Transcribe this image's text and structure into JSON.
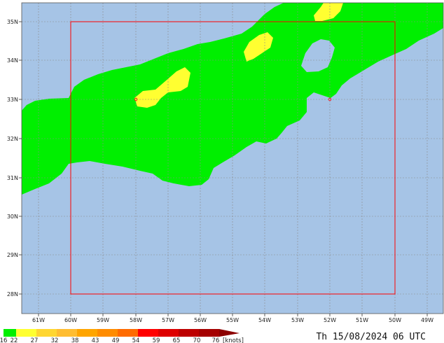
{
  "map": {
    "colors": {
      "sea": "#a6c4e6",
      "land_wind_16_22": "#00ef00",
      "wind_22_27": "#ffff31",
      "box": "#ff0000",
      "grid": "#8a8a8a"
    },
    "lon_labels": [
      "61W",
      "60W",
      "59W",
      "58W",
      "57W",
      "56W",
      "55W",
      "54W",
      "53W",
      "52W",
      "51W",
      "50W",
      "49W"
    ],
    "lat_labels": [
      "35N",
      "34N",
      "33N",
      "32N",
      "31N",
      "30N",
      "29N",
      "28N"
    ],
    "valid_time": "Th 15/08/2024 06 UTC"
  },
  "legend": {
    "labels": [
      "16",
      "22",
      "27",
      "32",
      "38",
      "43",
      "49",
      "54",
      "59",
      "65",
      "70",
      "76"
    ],
    "units": "[knots]",
    "colors": [
      "#00ef00",
      "#ffff31",
      "#ffd631",
      "#ffbd31",
      "#ffa500",
      "#ff8c00",
      "#ff6b00",
      "#ff0000",
      "#de0000",
      "#bd0000",
      "#a50000",
      "#8c0000"
    ]
  }
}
